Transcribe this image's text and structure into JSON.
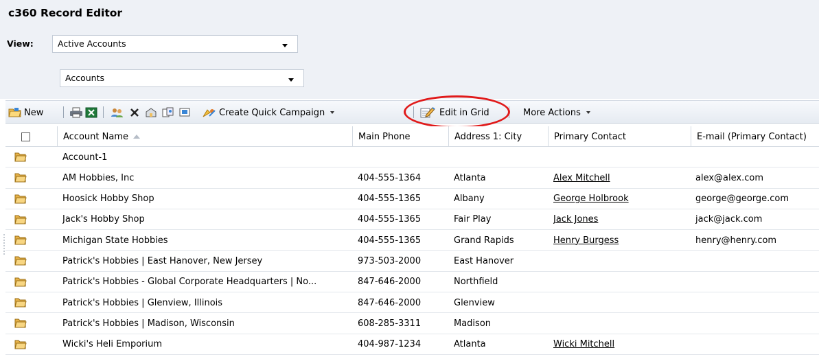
{
  "app": {
    "title": "c360 Record Editor"
  },
  "view": {
    "label": "View:",
    "selected": "Active Accounts",
    "entity": "Accounts"
  },
  "toolbar": {
    "new_label": "New",
    "create_quick_campaign_label": "Create Quick Campaign",
    "edit_in_grid_label": "Edit in Grid",
    "more_actions_label": "More Actions"
  },
  "grid": {
    "columns": [
      "Account Name",
      "Main Phone",
      "Address 1: City",
      "Primary Contact",
      "E-mail (Primary Contact)"
    ],
    "rows": [
      {
        "name": "Account-1",
        "phone": "",
        "city": "",
        "contact": "",
        "email": ""
      },
      {
        "name": "AM Hobbies, Inc",
        "phone": "404-555-1364",
        "city": "Atlanta",
        "contact": "Alex Mitchell",
        "email": "alex@alex.com"
      },
      {
        "name": "Hoosick Hobby Shop",
        "phone": "404-555-1365",
        "city": "Albany",
        "contact": "George Holbrook",
        "email": "george@george.com"
      },
      {
        "name": "Jack's Hobby Shop",
        "phone": "404-555-1365",
        "city": "Fair Play",
        "contact": "Jack Jones",
        "email": "jack@jack.com"
      },
      {
        "name": "Michigan State Hobbies",
        "phone": "404-555-1365",
        "city": "Grand Rapids",
        "contact": "Henry Burgess",
        "email": "henry@henry.com"
      },
      {
        "name": "Patrick's Hobbies | East Hanover, New Jersey",
        "phone": "973-503-2000",
        "city": "East Hanover",
        "contact": "",
        "email": ""
      },
      {
        "name": "Patrick's Hobbies - Global Corporate Headquarters | No...",
        "phone": "847-646-2000",
        "city": "Northfield",
        "contact": "",
        "email": ""
      },
      {
        "name": "Patrick's Hobbies | Glenview, Illinois",
        "phone": "847-646-2000",
        "city": "Glenview",
        "contact": "",
        "email": ""
      },
      {
        "name": "Patrick's Hobbies | Madison, Wisconsin",
        "phone": "608-285-3311",
        "city": "Madison",
        "contact": "",
        "email": ""
      },
      {
        "name": "Wicki's Heli Emporium",
        "phone": "404-987-1234",
        "city": "Atlanta",
        "contact": "Wicki Mitchell",
        "email": ""
      }
    ]
  },
  "icons": {
    "new": "new-record-icon",
    "print": "print-icon",
    "excel": "export-excel-icon",
    "assign": "assign-icon",
    "delete": "delete-icon",
    "share": "share-icon",
    "copy": "copy-link-icon",
    "email": "email-link-icon",
    "campaign": "quick-campaign-icon",
    "edit": "edit-in-grid-icon",
    "row": "account-record-icon"
  },
  "colors": {
    "highlight": "#e01a1a",
    "header_bg": "#eef1f6"
  }
}
